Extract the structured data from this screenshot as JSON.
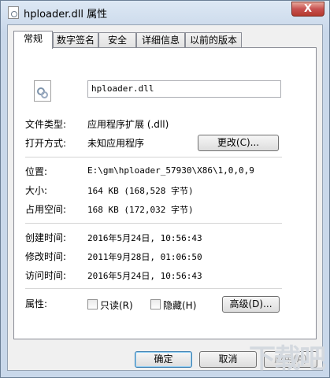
{
  "window": {
    "title": "hploader.dll 属性",
    "close_label": "X"
  },
  "tabs": [
    "常规",
    "数字签名",
    "安全",
    "详细信息",
    "以前的版本"
  ],
  "general": {
    "filename": "hploader.dll",
    "file_type_label": "文件类型:",
    "file_type_value": "应用程序扩展 (.dll)",
    "opens_with_label": "打开方式:",
    "opens_with_value": "未知应用程序",
    "change_button": "更改(C)...",
    "location_label": "位置:",
    "location_value": "E:\\gm\\hploader_57930\\X86\\1,0,0,9",
    "size_label": "大小:",
    "size_value": "164 KB (168,528 字节)",
    "size_on_disk_label": "占用空间:",
    "size_on_disk_value": "168 KB (172,032 字节)",
    "created_label": "创建时间:",
    "created_value": "2016年5月24日, 10:56:43",
    "modified_label": "修改时间:",
    "modified_value": "2011年9月28日, 01:06:50",
    "accessed_label": "访问时间:",
    "accessed_value": "2016年5月24日, 10:56:43",
    "attributes_label": "属性:",
    "readonly_label": "只读(R)",
    "readonly_checked": false,
    "hidden_label": "隐藏(H)",
    "hidden_checked": false,
    "advanced_button": "高级(D)..."
  },
  "footer": {
    "ok": "确定",
    "cancel": "取消",
    "apply": "应用(A)"
  },
  "watermark_text": "下载吧"
}
